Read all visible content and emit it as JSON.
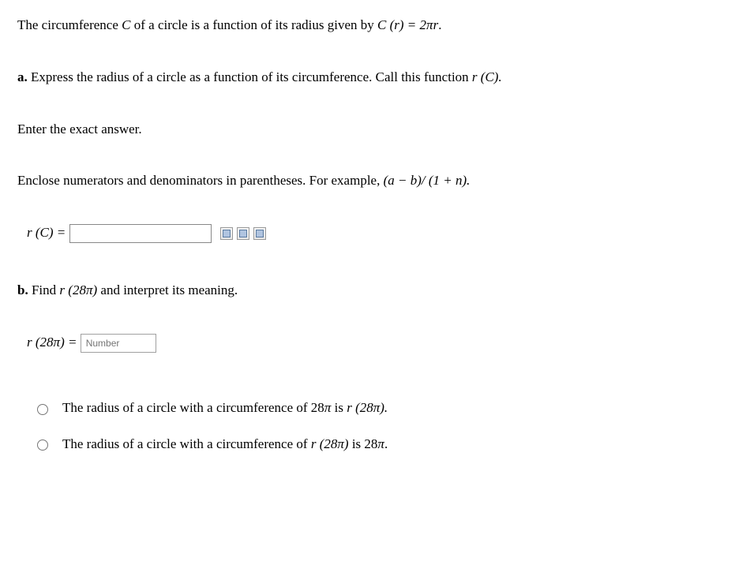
{
  "intro": {
    "pre": "The circumference ",
    "c": "C",
    "mid1": " of a circle is a function of its radius given by ",
    "func": "C",
    "of": " (r) = 2",
    "pi": "π",
    "r": "r",
    "end": "."
  },
  "partA": {
    "label": "a.",
    "text1": " Express the radius of a circle as a function of its circumference. Call this function ",
    "fn": "r",
    "fnarg": " (C).",
    "enter": "Enter the exact answer.",
    "enclose_pre": "Enclose numerators and denominators in parentheses. For example, ",
    "example_open": "(a − b)/ (1 + n).",
    "lhs_r": "r",
    "lhs_C": " (C) = "
  },
  "partB": {
    "label": "b.",
    "text_pre": " Find ",
    "fn": "r",
    "arg": " (28",
    "pi": "π",
    "close": ")",
    "text_post": " and interpret its meaning.",
    "lhs_r": "r",
    "lhs_arg": " (28",
    "lhs_pi": "π",
    "lhs_close": ") = ",
    "placeholder": "Number"
  },
  "choices": {
    "c1_pre": "The radius of a circle with a circumference of 28",
    "c1_pi": "π",
    "c1_mid": " is ",
    "c1_fn": "r",
    "c1_arg": " (28",
    "c1_pi2": "π",
    "c1_close": ").",
    "c2_pre": "The radius of a circle with a circumference of ",
    "c2_fn": "r",
    "c2_arg": " (28",
    "c2_pi": "π",
    "c2_close": ")",
    "c2_mid": " is 28",
    "c2_pi2": "π",
    "c2_end": "."
  }
}
